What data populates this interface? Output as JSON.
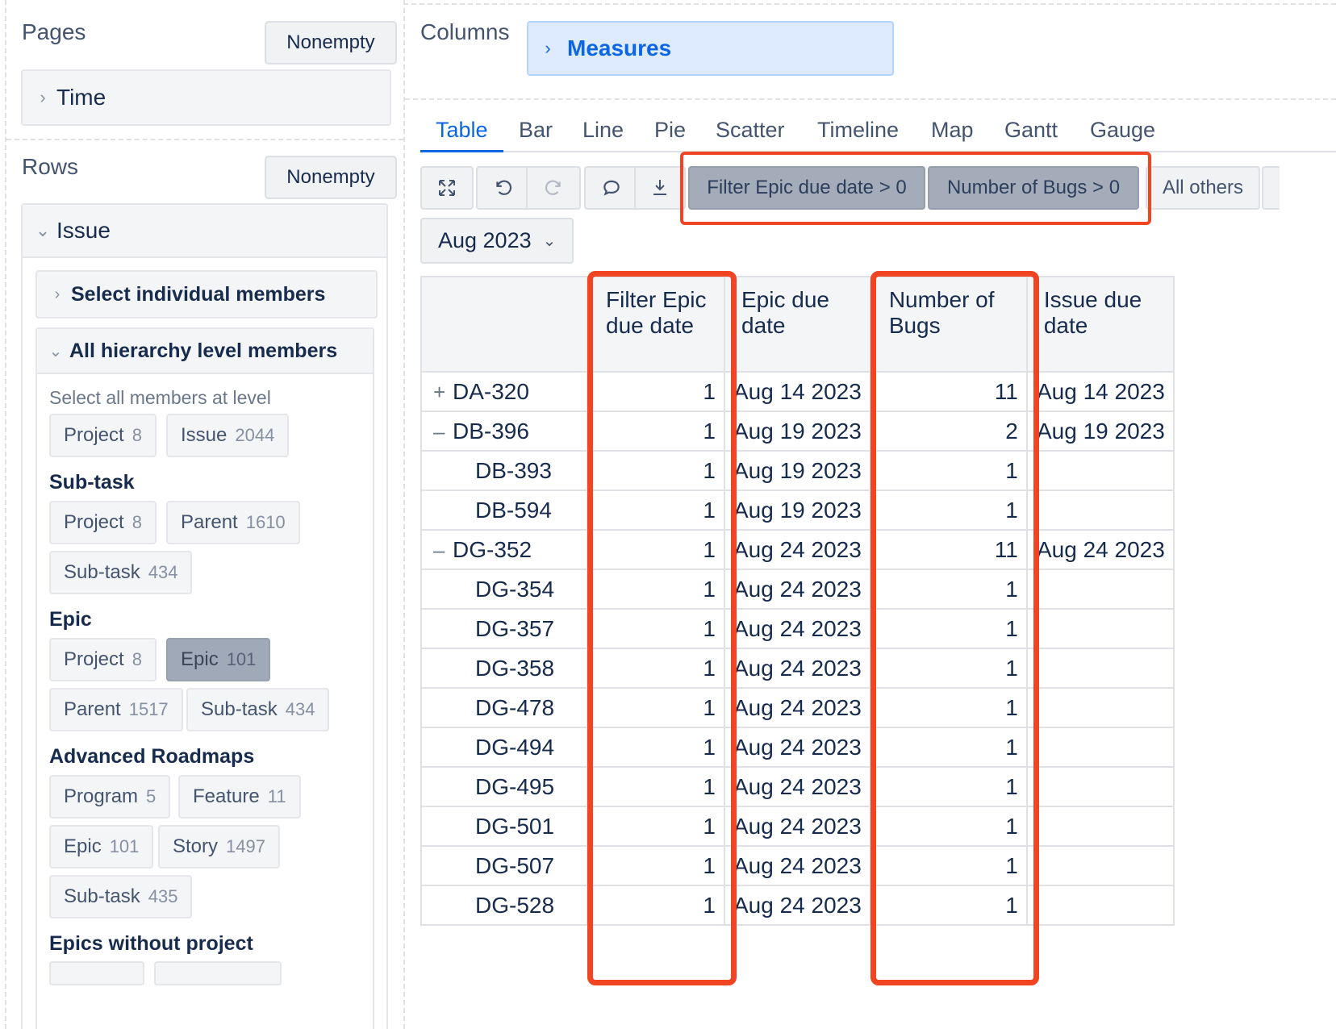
{
  "left": {
    "pages": {
      "title": "Pages",
      "nonempty": "Nonempty",
      "dimension": "Time"
    },
    "rows": {
      "title": "Rows",
      "nonempty": "Nonempty",
      "dimension": "Issue",
      "select_individual": "Select individual members",
      "all_hierarchy": "All hierarchy level members",
      "select_all_label": "Select all members at level",
      "level_chips": [
        {
          "label": "Project",
          "count": "8"
        },
        {
          "label": "Issue",
          "count": "2044"
        }
      ],
      "groups": [
        {
          "title": "Sub-task",
          "chips": [
            {
              "label": "Project",
              "count": "8"
            },
            {
              "label": "Parent",
              "count": "1610"
            },
            {
              "label": "Sub-task",
              "count": "434"
            }
          ]
        },
        {
          "title": "Epic",
          "chips": [
            {
              "label": "Project",
              "count": "8"
            },
            {
              "label": "Epic",
              "count": "101"
            },
            {
              "label": "Parent",
              "count": "1517"
            },
            {
              "label": "Sub-task",
              "count": "434"
            }
          ]
        },
        {
          "title": "Advanced Roadmaps",
          "chips": [
            {
              "label": "Program",
              "count": "5"
            },
            {
              "label": "Feature",
              "count": "11"
            },
            {
              "label": "Epic",
              "count": "101"
            },
            {
              "label": "Story",
              "count": "1497"
            },
            {
              "label": "Sub-task",
              "count": "435"
            }
          ]
        },
        {
          "title": "Epics without project"
        }
      ]
    }
  },
  "columns": {
    "title": "Columns",
    "measures": "Measures"
  },
  "tabs": [
    "Table",
    "Bar",
    "Line",
    "Pie",
    "Scatter",
    "Timeline",
    "Map",
    "Gantt",
    "Gauge"
  ],
  "toolbar": {
    "filters": [
      "Filter Epic due date > 0",
      "Number of Bugs > 0"
    ],
    "all_others": "All others",
    "page_select": "Aug 2023"
  },
  "table": {
    "headers": [
      "Filter Epic due date",
      "Epic due date",
      "Number of Bugs",
      "Issue due date"
    ],
    "rows": [
      {
        "expander": "+",
        "key": "DA-320",
        "filter": "1",
        "epic_due": "Aug 14 2023",
        "bugs": "11",
        "issue_due": "Aug 14 2023"
      },
      {
        "expander": "–",
        "key": "DB-396",
        "filter": "1",
        "epic_due": "Aug 19 2023",
        "bugs": "2",
        "issue_due": "Aug 19 2023"
      },
      {
        "expander": "",
        "key": "DB-393",
        "filter": "1",
        "epic_due": "Aug 19 2023",
        "bugs": "1",
        "issue_due": ""
      },
      {
        "expander": "",
        "key": "DB-594",
        "filter": "1",
        "epic_due": "Aug 19 2023",
        "bugs": "1",
        "issue_due": ""
      },
      {
        "expander": "–",
        "key": "DG-352",
        "filter": "1",
        "epic_due": "Aug 24 2023",
        "bugs": "11",
        "issue_due": "Aug 24 2023"
      },
      {
        "expander": "",
        "key": "DG-354",
        "filter": "1",
        "epic_due": "Aug 24 2023",
        "bugs": "1",
        "issue_due": ""
      },
      {
        "expander": "",
        "key": "DG-357",
        "filter": "1",
        "epic_due": "Aug 24 2023",
        "bugs": "1",
        "issue_due": ""
      },
      {
        "expander": "",
        "key": "DG-358",
        "filter": "1",
        "epic_due": "Aug 24 2023",
        "bugs": "1",
        "issue_due": ""
      },
      {
        "expander": "",
        "key": "DG-478",
        "filter": "1",
        "epic_due": "Aug 24 2023",
        "bugs": "1",
        "issue_due": ""
      },
      {
        "expander": "",
        "key": "DG-494",
        "filter": "1",
        "epic_due": "Aug 24 2023",
        "bugs": "1",
        "issue_due": ""
      },
      {
        "expander": "",
        "key": "DG-495",
        "filter": "1",
        "epic_due": "Aug 24 2023",
        "bugs": "1",
        "issue_due": ""
      },
      {
        "expander": "",
        "key": "DG-501",
        "filter": "1",
        "epic_due": "Aug 24 2023",
        "bugs": "1",
        "issue_due": ""
      },
      {
        "expander": "",
        "key": "DG-507",
        "filter": "1",
        "epic_due": "Aug 24 2023",
        "bugs": "1",
        "issue_due": ""
      },
      {
        "expander": "",
        "key": "DG-528",
        "filter": "1",
        "epic_due": "Aug 24 2023",
        "bugs": "1",
        "issue_due": ""
      }
    ]
  },
  "colors": {
    "highlight": "#f04423",
    "active_tab": "#0c66e4",
    "measures_bg": "#deebff"
  }
}
